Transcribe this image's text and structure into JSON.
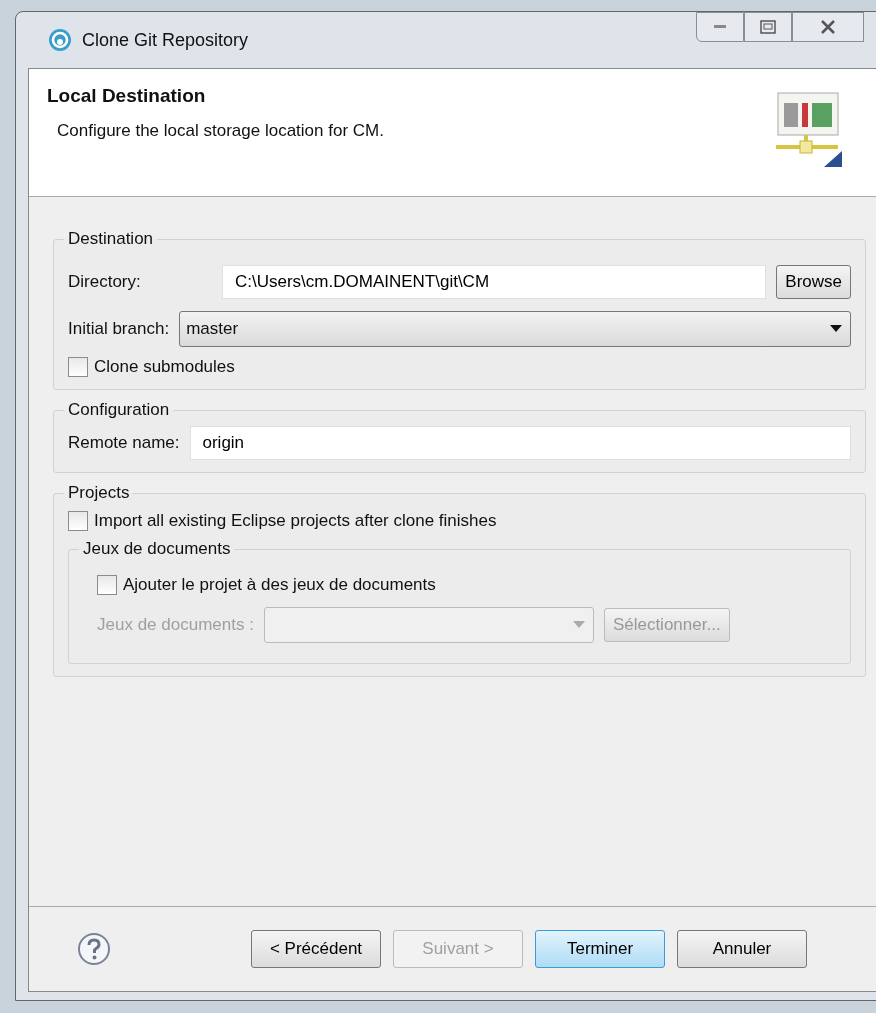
{
  "window": {
    "title": "Clone Git Repository"
  },
  "header": {
    "title": "Local Destination",
    "description": "Configure the local storage location for CM."
  },
  "destination": {
    "legend": "Destination",
    "directory_label": "Directory:",
    "directory_value": "C:\\Users\\cm.DOMAINENT\\git\\CM",
    "browse_button": "Browse",
    "branch_label": "Initial branch:",
    "branch_value": "master",
    "clone_submodules": {
      "label": "Clone submodules",
      "checked": false
    }
  },
  "configuration": {
    "legend": "Configuration",
    "remote_label": "Remote name:",
    "remote_value": "origin"
  },
  "projects": {
    "legend": "Projects",
    "import": {
      "label": "Import all existing Eclipse projects after clone finishes",
      "checked": false
    },
    "working_sets": {
      "legend": "Jeux de documents",
      "add": {
        "label": "Ajouter le projet à des jeux de documents",
        "checked": false
      },
      "sets_label": "Jeux de documents :",
      "select_button": "Sélectionner...",
      "disabled": true
    }
  },
  "buttons": [
    {
      "label": "< Précédent",
      "disabled": false,
      "default": false
    },
    {
      "label": "Suivant >",
      "disabled": true,
      "default": false
    },
    {
      "label": "Terminer",
      "disabled": false,
      "default": true
    },
    {
      "label": "Annuler",
      "disabled": false,
      "default": false
    }
  ]
}
